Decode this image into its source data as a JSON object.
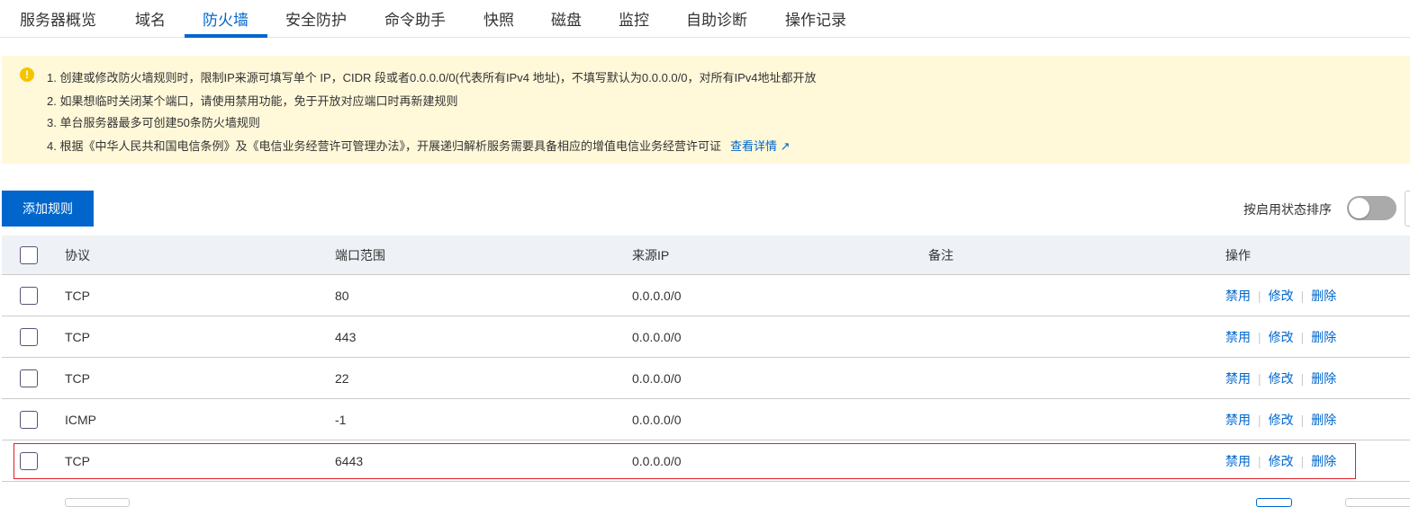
{
  "tabs": [
    "服务器概览",
    "域名",
    "防火墙",
    "安全防护",
    "命令助手",
    "快照",
    "磁盘",
    "监控",
    "自助诊断",
    "操作记录"
  ],
  "active_tab": "防火墙",
  "notice": {
    "lines": [
      "1. 创建或修改防火墙规则时，限制IP来源可填写单个 IP，CIDR 段或者0.0.0.0/0(代表所有IPv4 地址)，不填写默认为0.0.0.0/0，对所有IPv4地址都开放",
      "2. 如果想临时关闭某个端口，请使用禁用功能，免于开放对应端口时再新建规则",
      "3. 单台服务器最多可创建50条防火墙规则",
      "4. 根据《中华人民共和国电信条例》及《电信业务经营许可管理办法》，开展递归解析服务需要具备相应的增值电信业务经营许可证"
    ],
    "link": "查看详情"
  },
  "toolbar": {
    "add_rule": "添加规则",
    "sort_label": "按启用状态排序",
    "sort_enabled": false
  },
  "table": {
    "headers": {
      "protocol": "协议",
      "port": "端口范围",
      "source": "来源IP",
      "remark": "备注",
      "actions": "操作"
    },
    "rows": [
      {
        "protocol": "TCP",
        "port": "80",
        "source": "0.0.0.0/0",
        "remark": ""
      },
      {
        "protocol": "TCP",
        "port": "443",
        "source": "0.0.0.0/0",
        "remark": ""
      },
      {
        "protocol": "TCP",
        "port": "22",
        "source": "0.0.0.0/0",
        "remark": ""
      },
      {
        "protocol": "ICMP",
        "port": "-1",
        "source": "0.0.0.0/0",
        "remark": ""
      },
      {
        "protocol": "TCP",
        "port": "6443",
        "source": "0.0.0.0/0",
        "remark": ""
      }
    ],
    "actions": {
      "disable": "禁用",
      "edit": "修改",
      "delete": "删除"
    }
  }
}
